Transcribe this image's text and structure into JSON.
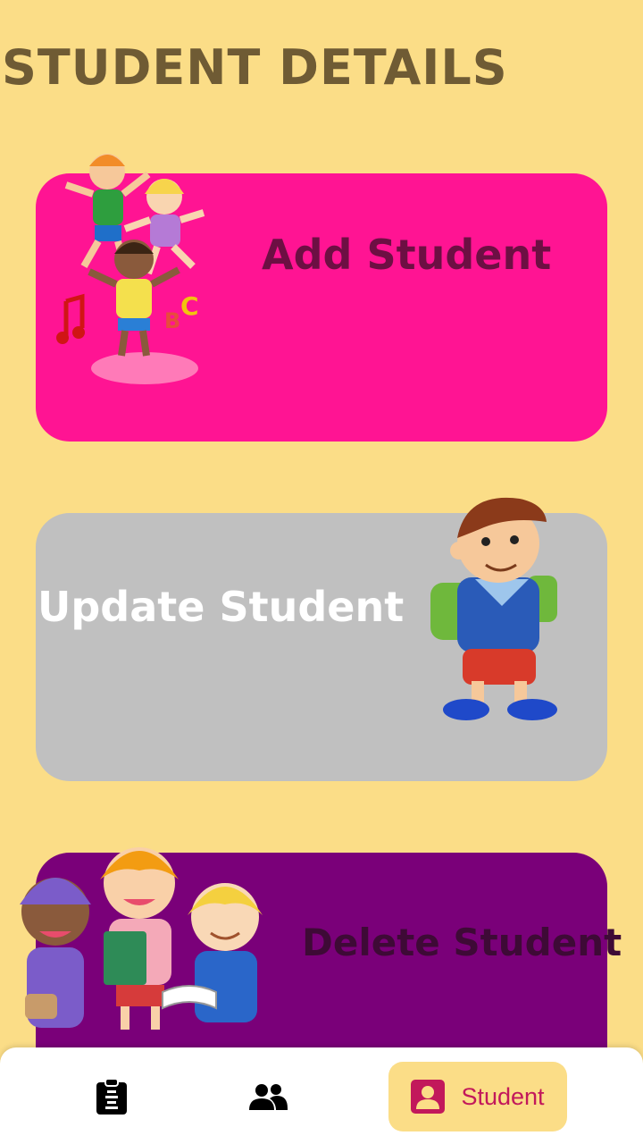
{
  "page": {
    "title": "STUDENT DETAILS",
    "background_color": "#fbdd87"
  },
  "cards": [
    {
      "label": "Add Student",
      "color": "#ff1493",
      "illustration": "kids-playing-illustration"
    },
    {
      "label": "Update Student",
      "color": "#c0c0c0",
      "illustration": "boy-with-backpack-illustration"
    },
    {
      "label": "Delete Student",
      "color": "#7a0079",
      "illustration": "kids-with-books-illustration"
    }
  ],
  "bottom_nav": {
    "items": [
      {
        "icon": "clipboard-icon",
        "label": "",
        "active": false
      },
      {
        "icon": "people-icon",
        "label": "",
        "active": false
      },
      {
        "icon": "person-badge-icon",
        "label": "Student",
        "active": true
      }
    ],
    "active_color": "#c2185b",
    "active_bg": "#fbdd87"
  }
}
